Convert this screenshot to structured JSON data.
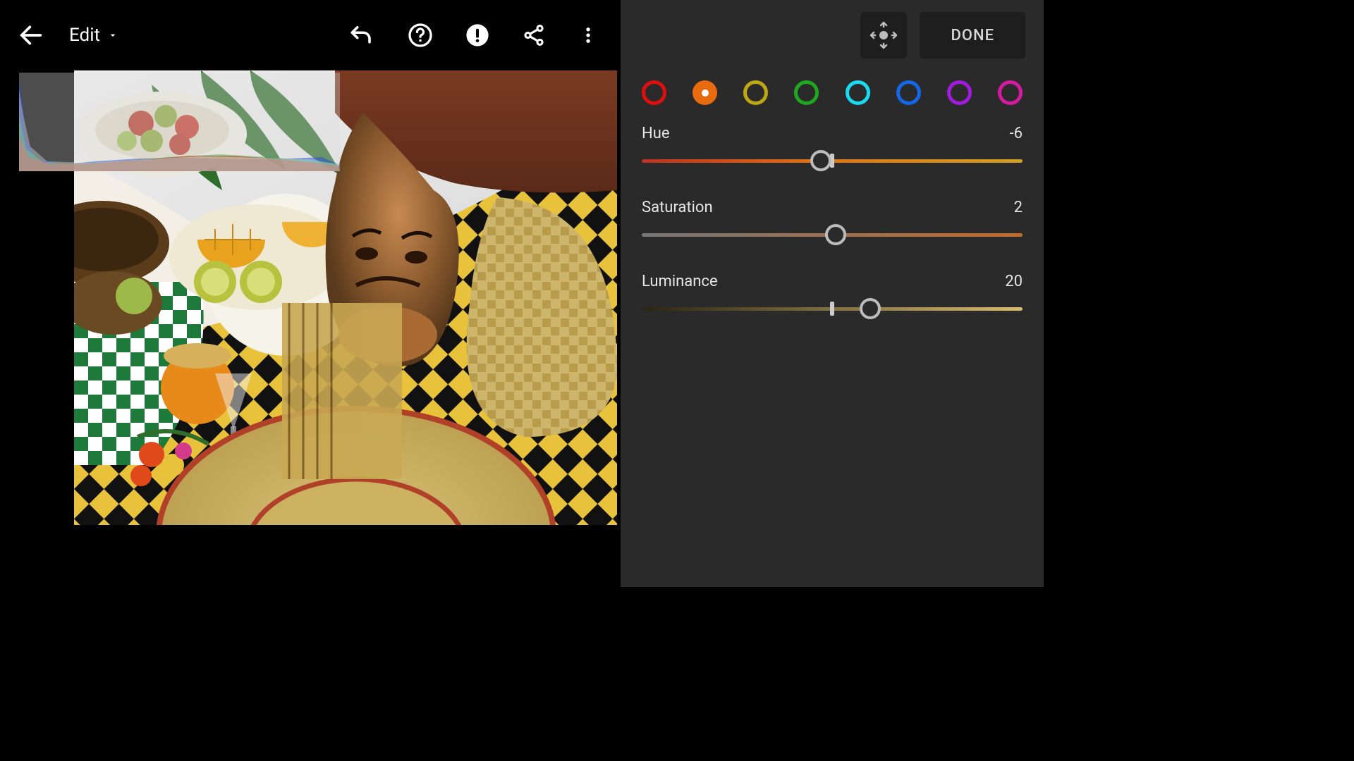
{
  "header": {
    "mode_label": "Edit"
  },
  "panel": {
    "done_label": "DONE",
    "colors": [
      {
        "name": "red",
        "hex": "#e00f0f",
        "selected": false
      },
      {
        "name": "orange",
        "hex": "#e86b0f",
        "selected": true
      },
      {
        "name": "yellow",
        "hex": "#bda813",
        "selected": false
      },
      {
        "name": "green",
        "hex": "#1fa81f",
        "selected": false
      },
      {
        "name": "aqua",
        "hex": "#1adaf0",
        "selected": false
      },
      {
        "name": "blue",
        "hex": "#1367e8",
        "selected": false
      },
      {
        "name": "purple",
        "hex": "#a21ae0",
        "selected": false
      },
      {
        "name": "magenta",
        "hex": "#d31aa0",
        "selected": false
      }
    ],
    "sliders": {
      "hue": {
        "label": "Hue",
        "value": -6,
        "min": -100,
        "max": 100,
        "gradient": "hue"
      },
      "saturation": {
        "label": "Saturation",
        "value": 2,
        "min": -100,
        "max": 100,
        "gradient": "sat"
      },
      "luminance": {
        "label": "Luminance",
        "value": 20,
        "min": -100,
        "max": 100,
        "gradient": "lum"
      }
    }
  }
}
